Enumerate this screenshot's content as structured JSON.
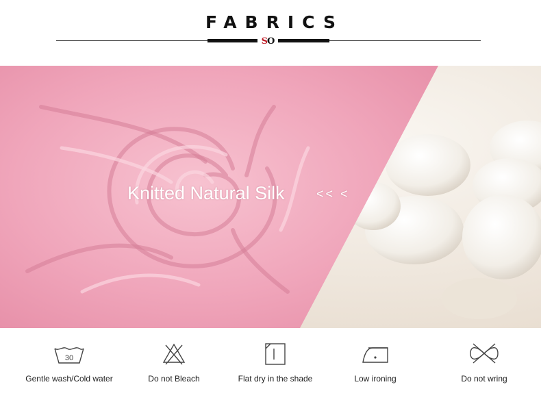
{
  "header": {
    "title": "FABRICS",
    "logo": {
      "text_s": "S",
      "text_o": "O",
      "accent_color": "#c0202a"
    }
  },
  "banner": {
    "caption": "Knitted Natural Silk",
    "arrows": "<< <",
    "fabric_color": "#f0a8bc",
    "cocoon_bg_color": "#efe7dc",
    "images": [
      "pink-silk-fabric",
      "white-silk-cocoons"
    ]
  },
  "care": {
    "items": [
      {
        "icon": "wash-tub-30-icon",
        "temp": "30",
        "label": "Gentle wash/Cold water"
      },
      {
        "icon": "no-bleach-icon",
        "label": "Do not Bleach"
      },
      {
        "icon": "flat-dry-shade-icon",
        "label": "Flat dry in the shade"
      },
      {
        "icon": "low-iron-icon",
        "label": "Low ironing"
      },
      {
        "icon": "no-wring-icon",
        "label": "Do not wring"
      }
    ]
  }
}
